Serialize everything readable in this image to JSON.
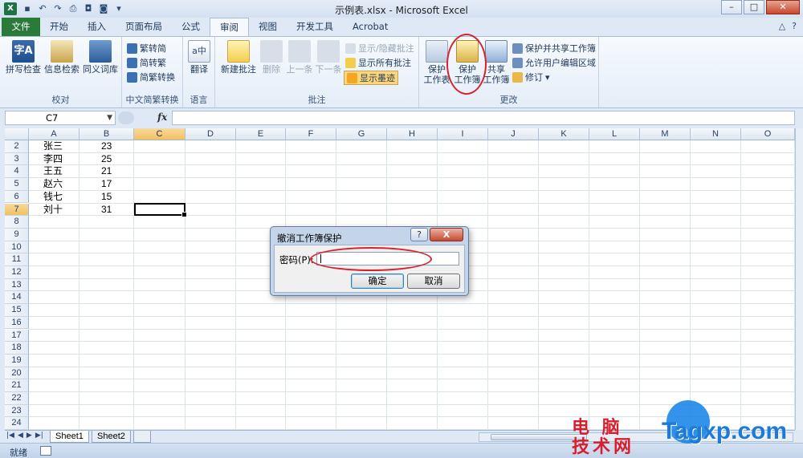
{
  "window": {
    "title": "示例表.xlsx - Microsoft Excel"
  },
  "tabs": [
    "文件",
    "开始",
    "插入",
    "页面布局",
    "公式",
    "审阅",
    "视图",
    "开发工具",
    "Acrobat"
  ],
  "active_tab": "审阅",
  "ribbon": {
    "proofing": {
      "label": "校对",
      "spell": "拼写检查",
      "research": "信息检索",
      "thesaurus": "同义词库"
    },
    "chinese": {
      "label": "中文简繁转换",
      "t2s": "繁转简",
      "s2t": "简转繁",
      "convert": "简繁转换"
    },
    "language": {
      "label": "语言",
      "translate": "翻译"
    },
    "comments": {
      "label": "批注",
      "new": "新建批注",
      "delete": "删除",
      "prev": "上一条",
      "next": "下一条",
      "show_hide": "显示/隐藏批注",
      "show_all": "显示所有批注",
      "show_ink": "显示墨迹"
    },
    "changes": {
      "label": "更改",
      "protect_sheet_1": "保护",
      "protect_sheet_2": "工作表",
      "protect_book_1": "保护",
      "protect_book_2": "工作簿",
      "share_1": "共享",
      "share_2": "工作簿",
      "protect_share": "保护并共享工作簿",
      "allow_edit": "允许用户编辑区域",
      "track": "修订"
    }
  },
  "formula_bar": {
    "name_box": "C7",
    "fx": "fx",
    "value": ""
  },
  "columns": [
    "A",
    "B",
    "C",
    "D",
    "E",
    "F",
    "G",
    "H",
    "I",
    "J",
    "K",
    "L",
    "M",
    "N",
    "O"
  ],
  "rows": [
    "2",
    "3",
    "4",
    "5",
    "6",
    "7",
    "8",
    "9",
    "10",
    "11",
    "12",
    "13",
    "14",
    "15",
    "16",
    "17",
    "18",
    "19",
    "20",
    "21",
    "22",
    "23",
    "24"
  ],
  "cells": [
    {
      "name": "张三",
      "value": "23"
    },
    {
      "name": "李四",
      "value": "25"
    },
    {
      "name": "王五",
      "value": "21"
    },
    {
      "name": "赵六",
      "value": "17"
    },
    {
      "name": "钱七",
      "value": "15"
    },
    {
      "name": "刘十",
      "value": "31"
    }
  ],
  "sheets": [
    "Sheet1",
    "Sheet2"
  ],
  "status": "就绪",
  "dialog": {
    "title": "撤消工作簿保护",
    "help": "?",
    "close": "X",
    "password_label": "密码(P):",
    "password_value": "",
    "ok": "确定",
    "cancel": "取消"
  },
  "watermark": {
    "line1": "电 脑",
    "line2": "技术网",
    "site": "Tagxp.com"
  },
  "colors": {
    "file_tab": "#2a7a3a",
    "annotation_ring": "#d6232a",
    "watermark_red": "#d91e2b",
    "watermark_blue": "#1e7ad9"
  }
}
